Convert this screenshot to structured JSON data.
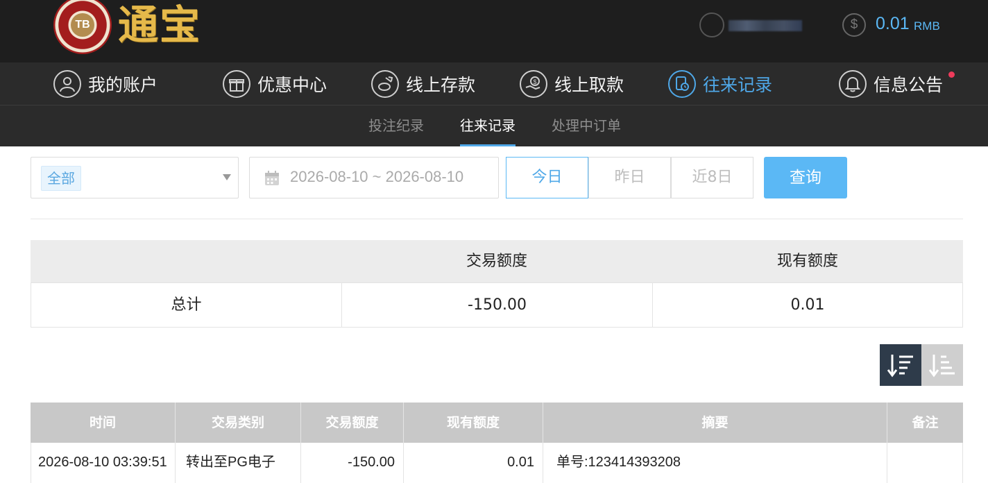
{
  "header": {
    "logo_badge": "TB",
    "logo_text": "通宝",
    "balance_icon": "dollar-icon",
    "balance_amount": "0.01",
    "balance_unit": "RMB"
  },
  "nav": {
    "items": [
      {
        "label": "我的账户",
        "icon": "user-icon"
      },
      {
        "label": "优惠中心",
        "icon": "gift-icon"
      },
      {
        "label": "线上存款",
        "icon": "deposit-icon"
      },
      {
        "label": "线上取款",
        "icon": "withdraw-icon"
      },
      {
        "label": "往来记录",
        "icon": "records-icon",
        "active": true
      },
      {
        "label": "信息公告",
        "icon": "bell-icon"
      }
    ],
    "active_color": "#4fa8e8",
    "notice_dot_color": "#ee3b5b"
  },
  "subnav": {
    "items": [
      {
        "label": "投注纪录"
      },
      {
        "label": "往来记录",
        "active": true
      },
      {
        "label": "处理中订单"
      }
    ]
  },
  "filters": {
    "type_selected": "全部",
    "date_range": "2026-08-10 ~ 2026-08-10",
    "quick": [
      "今日",
      "昨日",
      "近8日"
    ],
    "quick_active": "今日",
    "search_label": "查询",
    "search_color": "#5bb8f5"
  },
  "summary": {
    "headers": [
      "",
      "交易额度",
      "现有额度"
    ],
    "row": {
      "label": "总计",
      "amount": "-150.00",
      "balance": "0.01"
    }
  },
  "sort": {
    "desc_icon": "sort-desc-icon",
    "asc_icon": "sort-asc-icon"
  },
  "records": {
    "headers": [
      "时间",
      "交易类别",
      "交易额度",
      "现有额度",
      "摘要",
      "备注"
    ],
    "rows": [
      {
        "time": "2026-08-10 03:39:51",
        "type": "转出至PG电子",
        "amount": "-150.00",
        "balance": "0.01",
        "summary": "单号:123414393208",
        "note": ""
      }
    ]
  }
}
